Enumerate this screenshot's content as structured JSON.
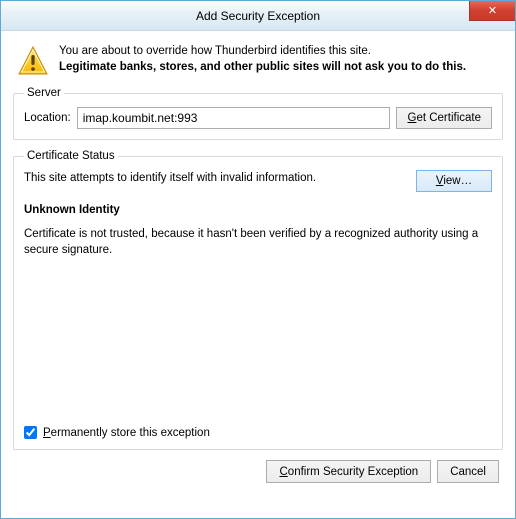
{
  "window": {
    "title": "Add Security Exception",
    "close": "✕"
  },
  "warning": {
    "line1": "You are about to override how Thunderbird identifies this site.",
    "line2": "Legitimate banks, stores, and other public sites will not ask you to do this."
  },
  "server": {
    "legend": "Server",
    "location_label": "Location:",
    "location_value": "imap.koumbit.net:993",
    "get_cert_prefix": "G",
    "get_cert_rest": "et Certificate"
  },
  "cert": {
    "legend": "Certificate Status",
    "attempt": "This site attempts to identify itself with invalid information.",
    "view_prefix": "V",
    "view_rest": "iew…",
    "heading": "Unknown Identity",
    "body": "Certificate is not trusted, because it hasn't been verified by a recognized authority using a secure signature.",
    "perm_prefix": "P",
    "perm_rest": "ermanently store this exception"
  },
  "footer": {
    "confirm_prefix": "C",
    "confirm_rest": "onfirm Security Exception",
    "cancel": "Cancel"
  }
}
